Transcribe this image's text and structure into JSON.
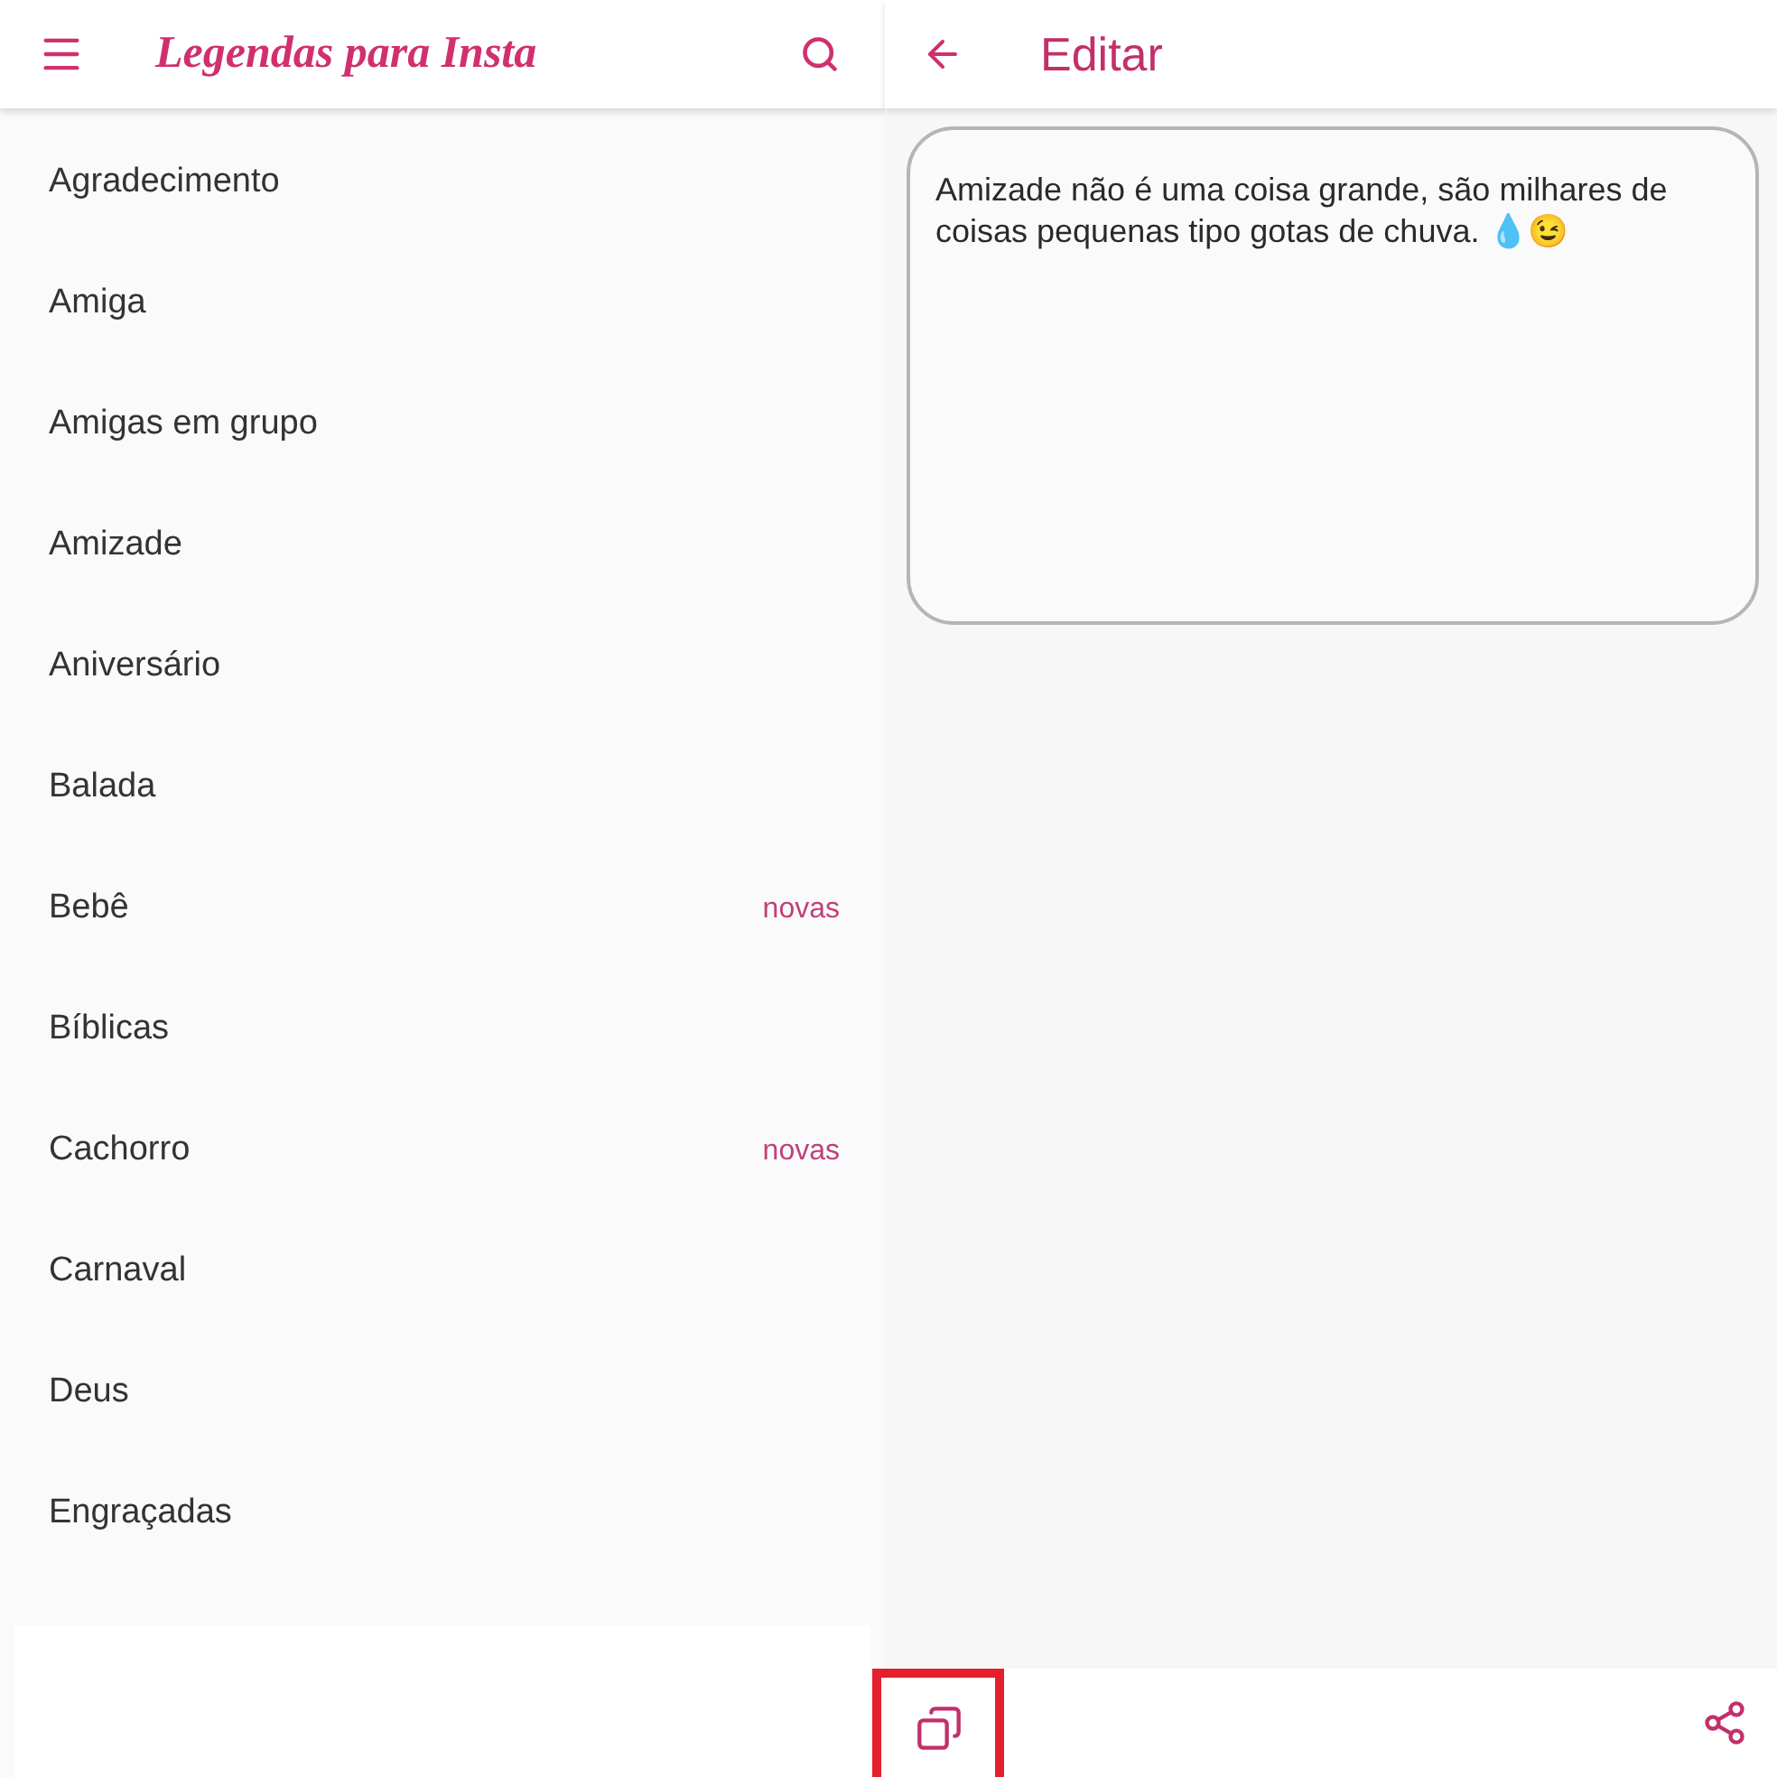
{
  "list_screen": {
    "title": "Legendas para Insta",
    "categories": [
      {
        "label": "Agradecimento"
      },
      {
        "label": "Amiga"
      },
      {
        "label": "Amigas em grupo"
      },
      {
        "label": "Amizade"
      },
      {
        "label": "Aniversário"
      },
      {
        "label": "Balada"
      },
      {
        "label": "Bebê",
        "badge": "novas"
      },
      {
        "label": "Bíblicas"
      },
      {
        "label": "Cachorro",
        "badge": "novas"
      },
      {
        "label": "Carnaval"
      },
      {
        "label": "Deus"
      },
      {
        "label": "Engraçadas"
      }
    ]
  },
  "editor_screen": {
    "title": "Editar",
    "text": "Amizade não é uma coisa grande, são milhares de coisas pequenas tipo gotas de chuva. 💧😉",
    "copy_highlighted": true
  }
}
